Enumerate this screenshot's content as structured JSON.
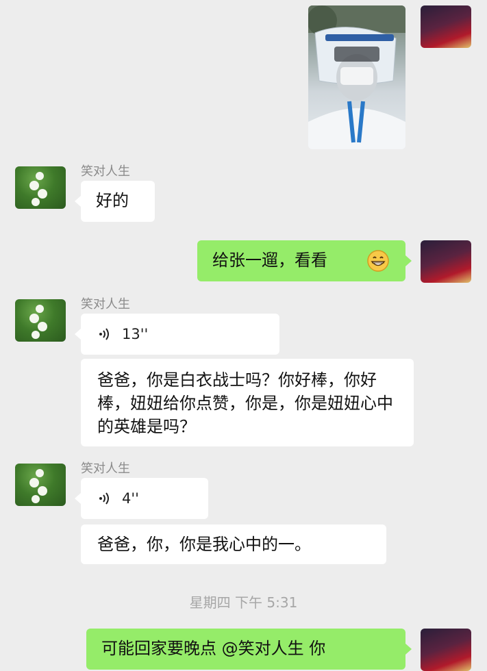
{
  "chat": {
    "timestamp": "星期四 下午 5:31",
    "messages": [
      {
        "sender": "self",
        "type": "image",
        "image_desc": "photo"
      },
      {
        "sender": "笑对人生",
        "type": "text",
        "text": "好的"
      },
      {
        "sender": "self",
        "type": "text",
        "text": "给张一遛，看看"
      },
      {
        "sender": "笑对人生",
        "type": "voice",
        "duration": "13''",
        "transcript": "爸爸，你是白衣战士吗？你好棒，你好棒，妞妞给你点赞，你是，你是妞妞心中的英雄是吗？"
      },
      {
        "sender": "笑对人生",
        "type": "voice",
        "duration": "4''",
        "transcript": "爸爸，你，你是我心中的一。"
      },
      {
        "sender": "self",
        "type": "text",
        "text": "可能回家要晚点 @笑对人生 你"
      }
    ]
  },
  "colors": {
    "background": "#ededed",
    "self_bubble": "#95ec69",
    "other_bubble": "#ffffff"
  },
  "icons": {
    "voice": "voice-wave-icon",
    "emoji": "grin-emoji-icon"
  }
}
